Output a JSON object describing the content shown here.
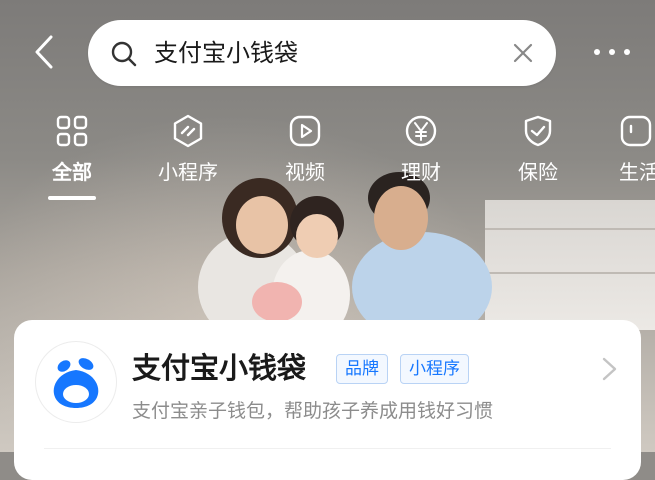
{
  "header": {
    "back_icon": "chevron-left-icon",
    "more_icon": "more-dots-icon"
  },
  "search": {
    "icon": "search-icon",
    "value": "支付宝小钱袋",
    "clear_icon": "close-icon"
  },
  "tabs": [
    {
      "label": "全部",
      "icon": "grid-icon",
      "active": true
    },
    {
      "label": "小程序",
      "icon": "mini-program-icon",
      "active": false
    },
    {
      "label": "视频",
      "icon": "play-icon",
      "active": false
    },
    {
      "label": "理财",
      "icon": "yuan-icon",
      "active": false
    },
    {
      "label": "保险",
      "icon": "shield-check-icon",
      "active": false
    },
    {
      "label": "生活",
      "icon": "life-icon",
      "active": false
    }
  ],
  "result": {
    "title": "支付宝小钱袋",
    "tags": [
      "品牌",
      "小程序"
    ],
    "description": "支付宝亲子钱包，帮助孩子养成用钱好习惯",
    "logo_icon": "pouch-logo-icon",
    "chevron_icon": "chevron-right-icon"
  },
  "colors": {
    "accent": "#1677ff",
    "tag_border": "#b9d3f5"
  }
}
